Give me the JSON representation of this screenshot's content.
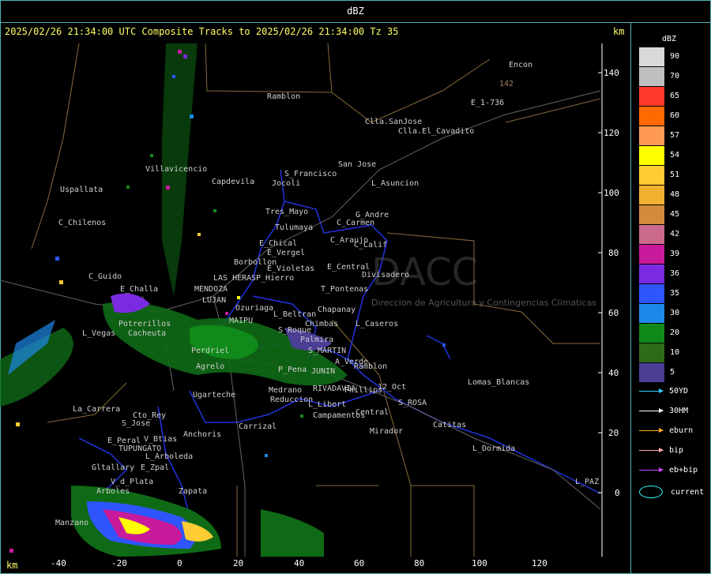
{
  "window_title": "dBZ",
  "header_text": "2025/02/26 21:34:00 UTC Composite Tracks to 2025/02/26 21:34:00 Tz 35",
  "km_label": "km",
  "y_axis_ticks": [
    "140",
    "120",
    "100",
    "80",
    "60",
    "40",
    "20",
    "0"
  ],
  "x_axis_ticks": [
    "-40",
    "-20",
    "0",
    "20",
    "40",
    "60",
    "80",
    "100",
    "120"
  ],
  "legend": {
    "title": "dBZ",
    "scale": [
      {
        "value": "90",
        "color": "#d9d9d9"
      },
      {
        "value": "70",
        "color": "#bfbfbf"
      },
      {
        "value": "65",
        "color": "#ff3a2a"
      },
      {
        "value": "60",
        "color": "#ff6a00"
      },
      {
        "value": "57",
        "color": "#ff9a55"
      },
      {
        "value": "54",
        "color": "#ffff00"
      },
      {
        "value": "51",
        "color": "#ffcc33"
      },
      {
        "value": "48",
        "color": "#f0b030"
      },
      {
        "value": "45",
        "color": "#d28a3c"
      },
      {
        "value": "42",
        "color": "#cc6a8e"
      },
      {
        "value": "39",
        "color": "#c81a9a"
      },
      {
        "value": "36",
        "color": "#7a2ae0"
      },
      {
        "value": "35",
        "color": "#2f55ff"
      },
      {
        "value": "30",
        "color": "#1e88e8"
      },
      {
        "value": "20",
        "color": "#0f8a1a"
      },
      {
        "value": "10",
        "color": "#2f6a1a"
      },
      {
        "value": "5",
        "color": "#4a3f94"
      }
    ],
    "tracks": [
      {
        "label": "50YD",
        "color": "#33ccff"
      },
      {
        "label": "30HM",
        "color": "#ffffff"
      },
      {
        "label": "eburn",
        "color": "#ffaa22"
      },
      {
        "label": "bip",
        "color": "#ffaaaa"
      },
      {
        "label": "eb+bip",
        "color": "#cc44ff"
      },
      {
        "label": "current",
        "color": "#33ffff"
      }
    ]
  },
  "places": [
    "Ramblon",
    "Encon",
    "142",
    "E_1-736",
    "Clla.SanJose",
    "Clla.El_Cavadito",
    "San Jose",
    "S_Francisco",
    "Jocoli",
    "L_Asuncion",
    "Uspallata",
    "Villavicencio",
    "Capdevila",
    "Tres_Mayo",
    "G_Andre",
    "Tulumaya",
    "C_Carmen",
    "C_Chilenos",
    "E_Chical",
    "C_Araujo",
    "E_Vergel",
    "C_Calif",
    "Borbollon",
    "E_Central",
    "E_Violetas",
    "Divisadero",
    "C_Guido",
    "P_Hierro",
    "E_Challa",
    "MENDOZA",
    "LAS HERAS",
    "T_Pontenas",
    "LUJAN",
    "Ozuriaga",
    "Chapanay",
    "Potrerillos",
    "MAIPU",
    "L_Beltran",
    "Chimbas",
    "L_Caseros",
    "L_Vegas",
    "Cacheuta",
    "S_Roque",
    "Palmira",
    "S_MARTIN",
    "Perdriel",
    "Agrelo",
    "A_Verde",
    "Ramblon",
    "P_Pena",
    "JUNIN",
    "Lomas_Blancas",
    "Ugarteche",
    "RIVADAVIA",
    "Medrano",
    "Phillips",
    "12_Oct",
    "Reduccion",
    "L_Libert",
    "S_ROSA",
    "La_Carrera",
    "Central",
    "Cto_Rey",
    "Campamentos",
    "S_Jose",
    "Carrizal",
    "Catitas",
    "Anchoris",
    "Mirador",
    "E_Peral",
    "V_Btias",
    "TUPUNGATO",
    "L_Dormida",
    "L_Arboleda",
    "Gltallary",
    "E_Zpal",
    "V_d_Plata",
    "L_PAZ",
    "Arboles",
    "Zapata",
    "Manzano",
    "Direccion de Agricultura y Contingencias Climaticas",
    "DACC"
  ]
}
